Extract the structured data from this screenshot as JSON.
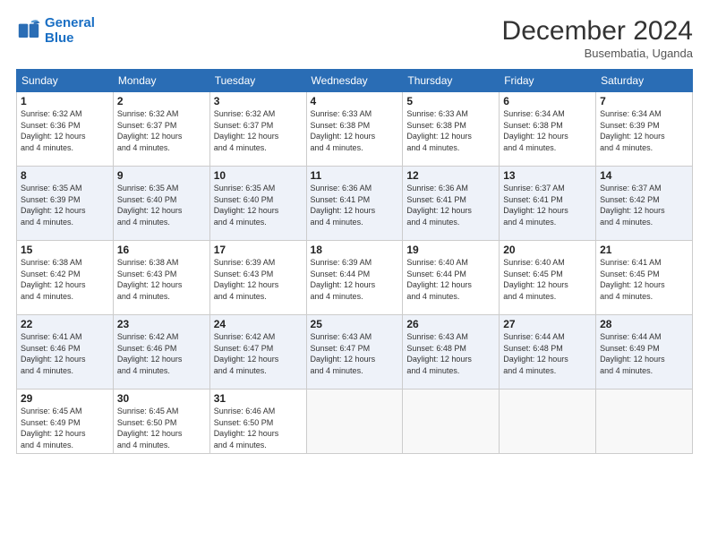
{
  "logo": {
    "text_general": "General",
    "text_blue": "Blue"
  },
  "header": {
    "month": "December 2024",
    "location": "Busembatia, Uganda"
  },
  "days_of_week": [
    "Sunday",
    "Monday",
    "Tuesday",
    "Wednesday",
    "Thursday",
    "Friday",
    "Saturday"
  ],
  "weeks": [
    [
      {
        "day": "1",
        "info": "Sunrise: 6:32 AM\nSunset: 6:36 PM\nDaylight: 12 hours\nand 4 minutes."
      },
      {
        "day": "2",
        "info": "Sunrise: 6:32 AM\nSunset: 6:37 PM\nDaylight: 12 hours\nand 4 minutes."
      },
      {
        "day": "3",
        "info": "Sunrise: 6:32 AM\nSunset: 6:37 PM\nDaylight: 12 hours\nand 4 minutes."
      },
      {
        "day": "4",
        "info": "Sunrise: 6:33 AM\nSunset: 6:38 PM\nDaylight: 12 hours\nand 4 minutes."
      },
      {
        "day": "5",
        "info": "Sunrise: 6:33 AM\nSunset: 6:38 PM\nDaylight: 12 hours\nand 4 minutes."
      },
      {
        "day": "6",
        "info": "Sunrise: 6:34 AM\nSunset: 6:38 PM\nDaylight: 12 hours\nand 4 minutes."
      },
      {
        "day": "7",
        "info": "Sunrise: 6:34 AM\nSunset: 6:39 PM\nDaylight: 12 hours\nand 4 minutes."
      }
    ],
    [
      {
        "day": "8",
        "info": "Sunrise: 6:35 AM\nSunset: 6:39 PM\nDaylight: 12 hours\nand 4 minutes."
      },
      {
        "day": "9",
        "info": "Sunrise: 6:35 AM\nSunset: 6:40 PM\nDaylight: 12 hours\nand 4 minutes."
      },
      {
        "day": "10",
        "info": "Sunrise: 6:35 AM\nSunset: 6:40 PM\nDaylight: 12 hours\nand 4 minutes."
      },
      {
        "day": "11",
        "info": "Sunrise: 6:36 AM\nSunset: 6:41 PM\nDaylight: 12 hours\nand 4 minutes."
      },
      {
        "day": "12",
        "info": "Sunrise: 6:36 AM\nSunset: 6:41 PM\nDaylight: 12 hours\nand 4 minutes."
      },
      {
        "day": "13",
        "info": "Sunrise: 6:37 AM\nSunset: 6:41 PM\nDaylight: 12 hours\nand 4 minutes."
      },
      {
        "day": "14",
        "info": "Sunrise: 6:37 AM\nSunset: 6:42 PM\nDaylight: 12 hours\nand 4 minutes."
      }
    ],
    [
      {
        "day": "15",
        "info": "Sunrise: 6:38 AM\nSunset: 6:42 PM\nDaylight: 12 hours\nand 4 minutes."
      },
      {
        "day": "16",
        "info": "Sunrise: 6:38 AM\nSunset: 6:43 PM\nDaylight: 12 hours\nand 4 minutes."
      },
      {
        "day": "17",
        "info": "Sunrise: 6:39 AM\nSunset: 6:43 PM\nDaylight: 12 hours\nand 4 minutes."
      },
      {
        "day": "18",
        "info": "Sunrise: 6:39 AM\nSunset: 6:44 PM\nDaylight: 12 hours\nand 4 minutes."
      },
      {
        "day": "19",
        "info": "Sunrise: 6:40 AM\nSunset: 6:44 PM\nDaylight: 12 hours\nand 4 minutes."
      },
      {
        "day": "20",
        "info": "Sunrise: 6:40 AM\nSunset: 6:45 PM\nDaylight: 12 hours\nand 4 minutes."
      },
      {
        "day": "21",
        "info": "Sunrise: 6:41 AM\nSunset: 6:45 PM\nDaylight: 12 hours\nand 4 minutes."
      }
    ],
    [
      {
        "day": "22",
        "info": "Sunrise: 6:41 AM\nSunset: 6:46 PM\nDaylight: 12 hours\nand 4 minutes."
      },
      {
        "day": "23",
        "info": "Sunrise: 6:42 AM\nSunset: 6:46 PM\nDaylight: 12 hours\nand 4 minutes."
      },
      {
        "day": "24",
        "info": "Sunrise: 6:42 AM\nSunset: 6:47 PM\nDaylight: 12 hours\nand 4 minutes."
      },
      {
        "day": "25",
        "info": "Sunrise: 6:43 AM\nSunset: 6:47 PM\nDaylight: 12 hours\nand 4 minutes."
      },
      {
        "day": "26",
        "info": "Sunrise: 6:43 AM\nSunset: 6:48 PM\nDaylight: 12 hours\nand 4 minutes."
      },
      {
        "day": "27",
        "info": "Sunrise: 6:44 AM\nSunset: 6:48 PM\nDaylight: 12 hours\nand 4 minutes."
      },
      {
        "day": "28",
        "info": "Sunrise: 6:44 AM\nSunset: 6:49 PM\nDaylight: 12 hours\nand 4 minutes."
      }
    ],
    [
      {
        "day": "29",
        "info": "Sunrise: 6:45 AM\nSunset: 6:49 PM\nDaylight: 12 hours\nand 4 minutes."
      },
      {
        "day": "30",
        "info": "Sunrise: 6:45 AM\nSunset: 6:50 PM\nDaylight: 12 hours\nand 4 minutes."
      },
      {
        "day": "31",
        "info": "Sunrise: 6:46 AM\nSunset: 6:50 PM\nDaylight: 12 hours\nand 4 minutes."
      },
      {
        "day": "",
        "info": ""
      },
      {
        "day": "",
        "info": ""
      },
      {
        "day": "",
        "info": ""
      },
      {
        "day": "",
        "info": ""
      }
    ]
  ]
}
